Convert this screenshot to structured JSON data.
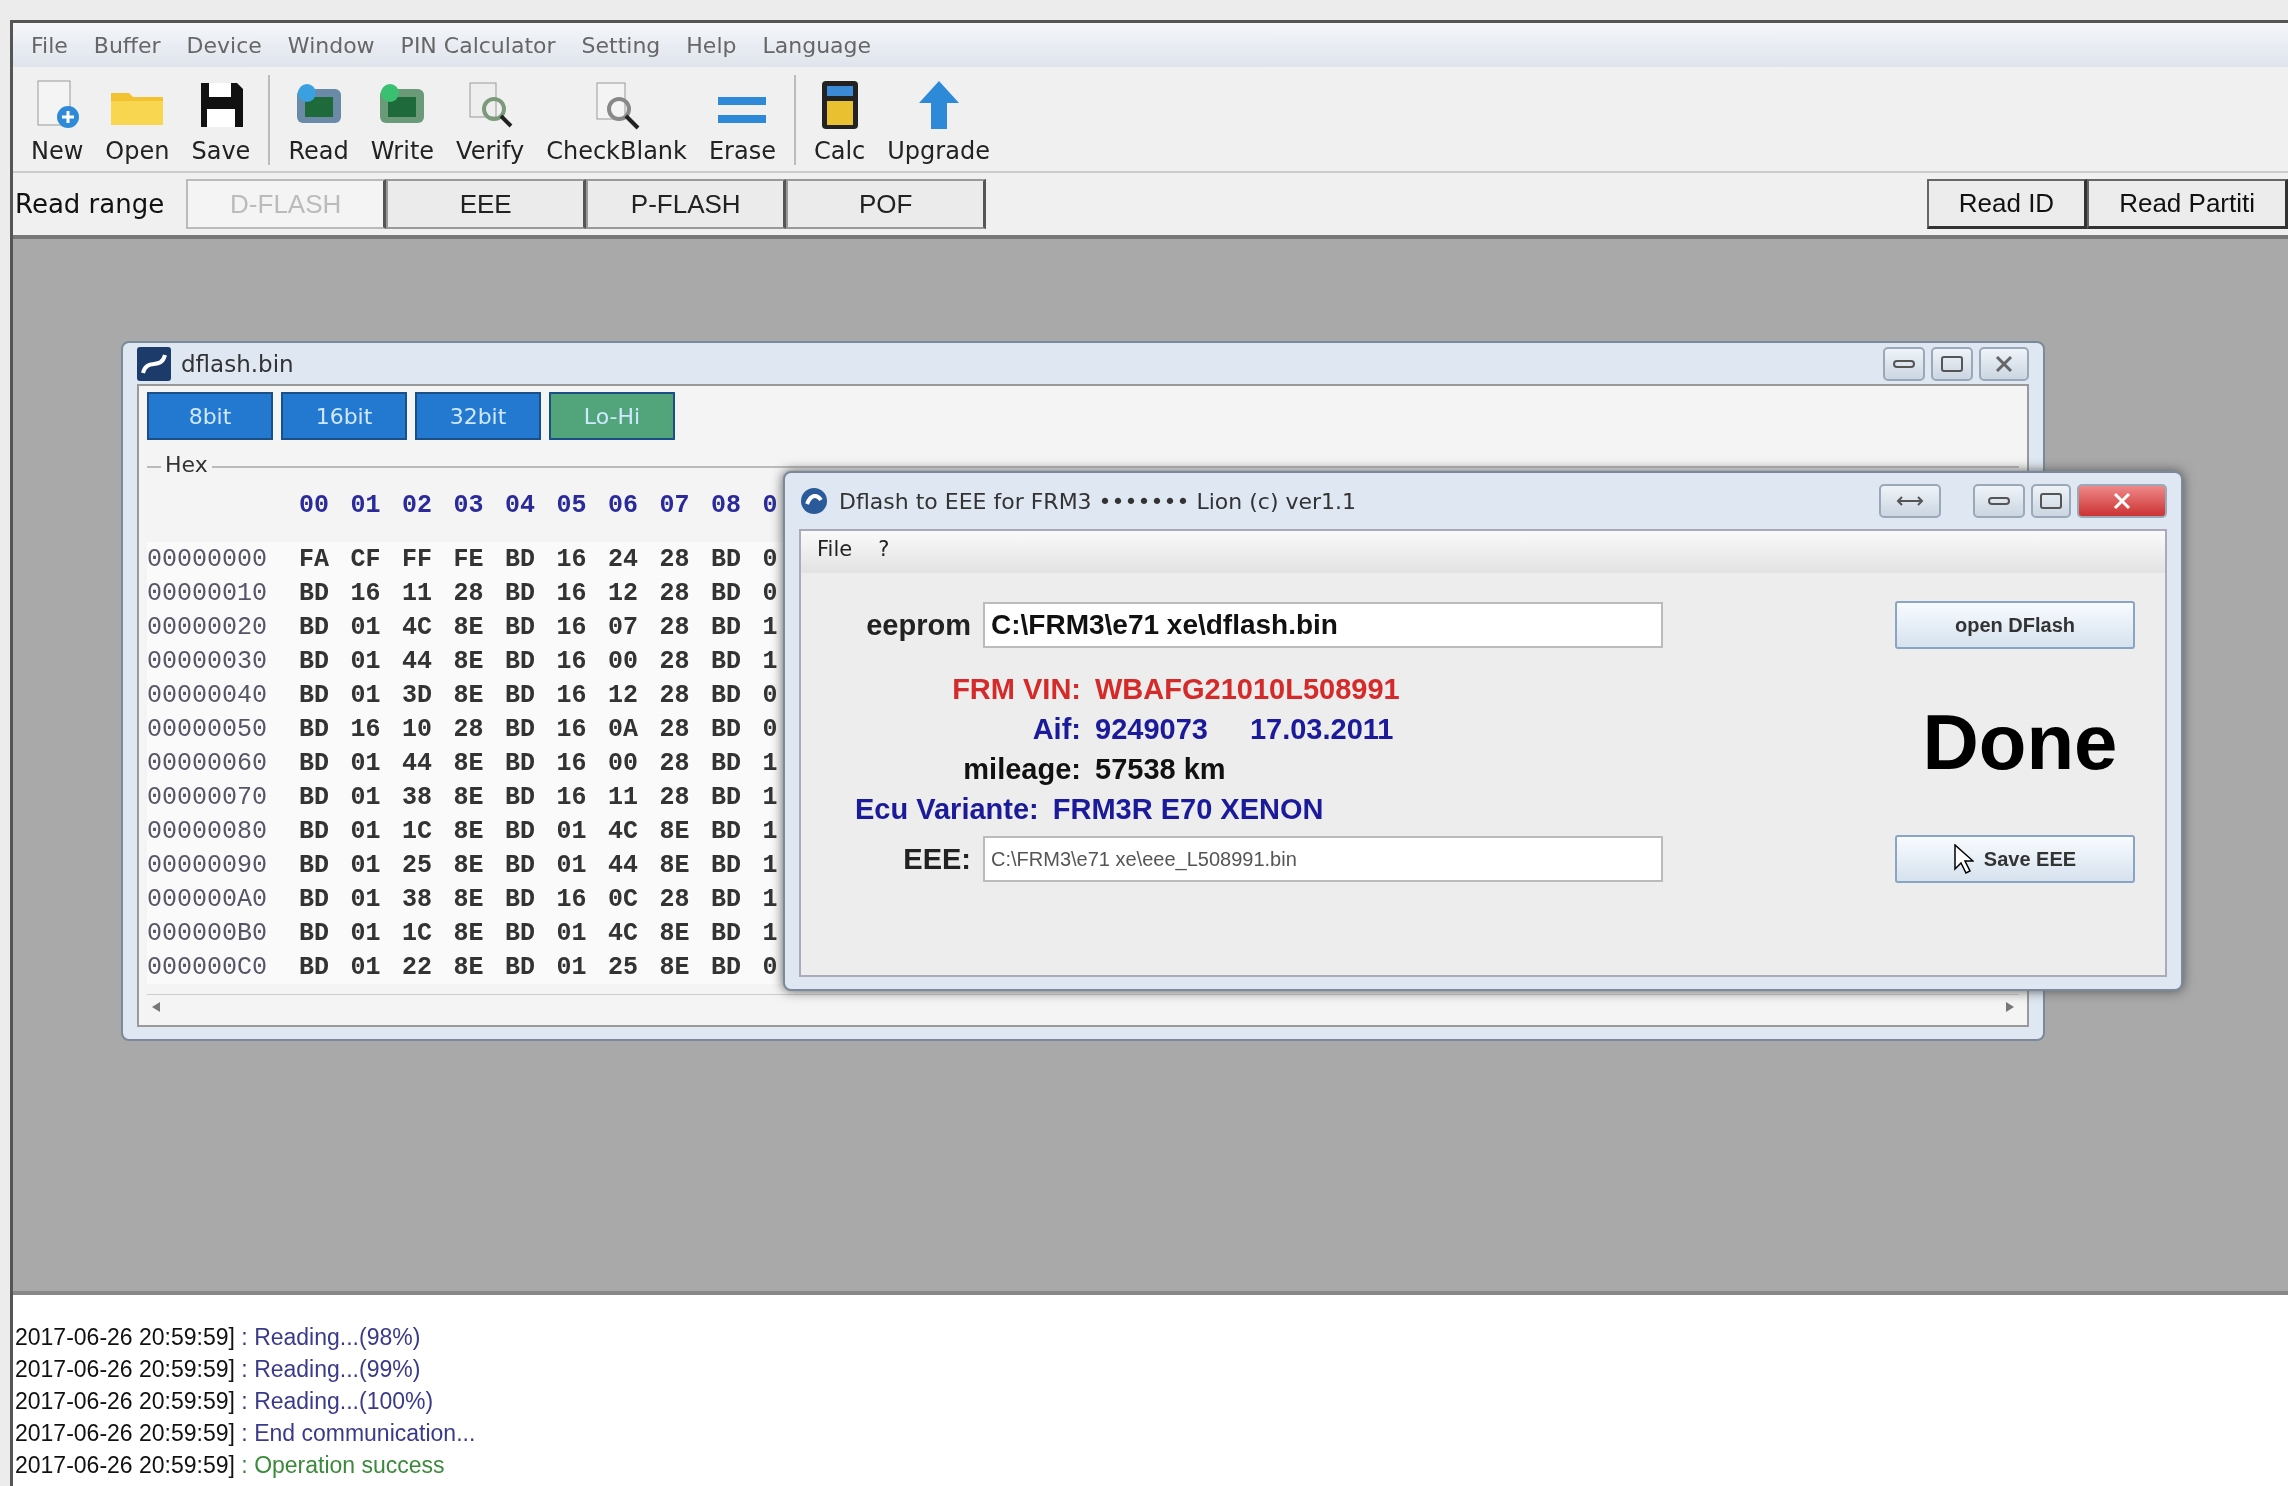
{
  "menu": [
    "File",
    "Buffer",
    "Device",
    "Window",
    "PIN Calculator",
    "Setting",
    "Help",
    "Language"
  ],
  "toolbar": [
    {
      "label": "New",
      "kind": "new"
    },
    {
      "label": "Open",
      "kind": "open"
    },
    {
      "label": "Save",
      "kind": "save"
    },
    {
      "label": "Read",
      "kind": "read"
    },
    {
      "label": "Write",
      "kind": "write"
    },
    {
      "label": "Verify",
      "kind": "verify"
    },
    {
      "label": "CheckBlank",
      "kind": "checkblank"
    },
    {
      "label": "Erase",
      "kind": "erase"
    },
    {
      "label": "Calc",
      "kind": "calc"
    },
    {
      "label": "Upgrade",
      "kind": "upgrade"
    }
  ],
  "range_bar": {
    "label": "Read range",
    "tabs": [
      {
        "label": "D-FLASH",
        "disabled": true
      },
      {
        "label": "EEE",
        "disabled": false
      },
      {
        "label": "P-FLASH",
        "disabled": false
      },
      {
        "label": "POF",
        "disabled": false
      }
    ],
    "buttons": [
      "Read ID",
      "Read Partiti"
    ]
  },
  "hex_window": {
    "title": "dflash.bin",
    "modes": [
      {
        "label": "8bit",
        "selected": false
      },
      {
        "label": "16bit",
        "selected": false
      },
      {
        "label": "32bit",
        "selected": false
      },
      {
        "label": "Lo-Hi",
        "selected": true
      }
    ],
    "group": "Hex",
    "columns": [
      "00",
      "01",
      "02",
      "03",
      "04",
      "05",
      "06",
      "07",
      "08",
      "0"
    ],
    "rows": [
      {
        "address": "00000000",
        "bytes": [
          "FA",
          "CF",
          "FF",
          "FE",
          "BD",
          "16",
          "24",
          "28",
          "BD",
          "0"
        ]
      },
      {
        "address": "00000010",
        "bytes": [
          "BD",
          "16",
          "11",
          "28",
          "BD",
          "16",
          "12",
          "28",
          "BD",
          "0"
        ]
      },
      {
        "address": "00000020",
        "bytes": [
          "BD",
          "01",
          "4C",
          "8E",
          "BD",
          "16",
          "07",
          "28",
          "BD",
          "1"
        ]
      },
      {
        "address": "00000030",
        "bytes": [
          "BD",
          "01",
          "44",
          "8E",
          "BD",
          "16",
          "00",
          "28",
          "BD",
          "1"
        ]
      },
      {
        "address": "00000040",
        "bytes": [
          "BD",
          "01",
          "3D",
          "8E",
          "BD",
          "16",
          "12",
          "28",
          "BD",
          "0"
        ]
      },
      {
        "address": "00000050",
        "bytes": [
          "BD",
          "16",
          "10",
          "28",
          "BD",
          "16",
          "0A",
          "28",
          "BD",
          "0"
        ]
      },
      {
        "address": "00000060",
        "bytes": [
          "BD",
          "01",
          "44",
          "8E",
          "BD",
          "16",
          "00",
          "28",
          "BD",
          "1"
        ]
      },
      {
        "address": "00000070",
        "bytes": [
          "BD",
          "01",
          "38",
          "8E",
          "BD",
          "16",
          "11",
          "28",
          "BD",
          "1"
        ]
      },
      {
        "address": "00000080",
        "bytes": [
          "BD",
          "01",
          "1C",
          "8E",
          "BD",
          "01",
          "4C",
          "8E",
          "BD",
          "1"
        ]
      },
      {
        "address": "00000090",
        "bytes": [
          "BD",
          "01",
          "25",
          "8E",
          "BD",
          "01",
          "44",
          "8E",
          "BD",
          "1"
        ]
      },
      {
        "address": "000000A0",
        "bytes": [
          "BD",
          "01",
          "38",
          "8E",
          "BD",
          "16",
          "0C",
          "28",
          "BD",
          "1"
        ]
      },
      {
        "address": "000000B0",
        "bytes": [
          "BD",
          "01",
          "1C",
          "8E",
          "BD",
          "01",
          "4C",
          "8E",
          "BD",
          "1"
        ]
      },
      {
        "address": "000000C0",
        "bytes": [
          "BD",
          "01",
          "22",
          "8E",
          "BD",
          "01",
          "25",
          "8E",
          "BD",
          "0"
        ]
      }
    ]
  },
  "dialog": {
    "title": "Dflash to EEE for FRM3 ••••••• Lion (c) ver1.1",
    "menu": [
      "File",
      "?"
    ],
    "eeprom_label": "eeprom",
    "eeprom_value": "C:\\FRM3\\e71 xe\\dflash.bin",
    "open_button": "open DFlash",
    "info": [
      {
        "kind": "aligned",
        "label": "FRM VIN:",
        "values": [
          "WBAFG21010L508991"
        ],
        "color": "#d42a2a"
      },
      {
        "kind": "aligned",
        "label": "Aif:",
        "values": [
          "9249073",
          "17.03.2011"
        ],
        "color": "#1a1a9a"
      },
      {
        "kind": "aligned",
        "label": "mileage:",
        "values": [
          "57538 km"
        ],
        "color": "#111111"
      },
      {
        "kind": "free",
        "label": "Ecu Variante:",
        "values": [
          "FRM3R E70 XENON"
        ],
        "color": "#1a1a9a"
      }
    ],
    "status": "Done",
    "eee_label": "EEE:",
    "eee_value": "C:\\FRM3\\e71 xe\\eee_L508991.bin",
    "save_button": "Save EEE"
  },
  "log": [
    {
      "time": "2017-06-26 20:59:59]",
      "message": ": Reading...(98%)",
      "color": "#3a3a8c"
    },
    {
      "time": "2017-06-26 20:59:59]",
      "message": ": Reading...(99%)",
      "color": "#3a3a8c"
    },
    {
      "time": "2017-06-26 20:59:59]",
      "message": ": Reading...(100%)",
      "color": "#3a3a8c"
    },
    {
      "time": "2017-06-26 20:59:59]",
      "message": ": End communication...",
      "color": "#3a3a8c"
    },
    {
      "time": "2017-06-26 20:59:59]",
      "message": ": Operation success",
      "color": "#3a8a3a"
    }
  ]
}
